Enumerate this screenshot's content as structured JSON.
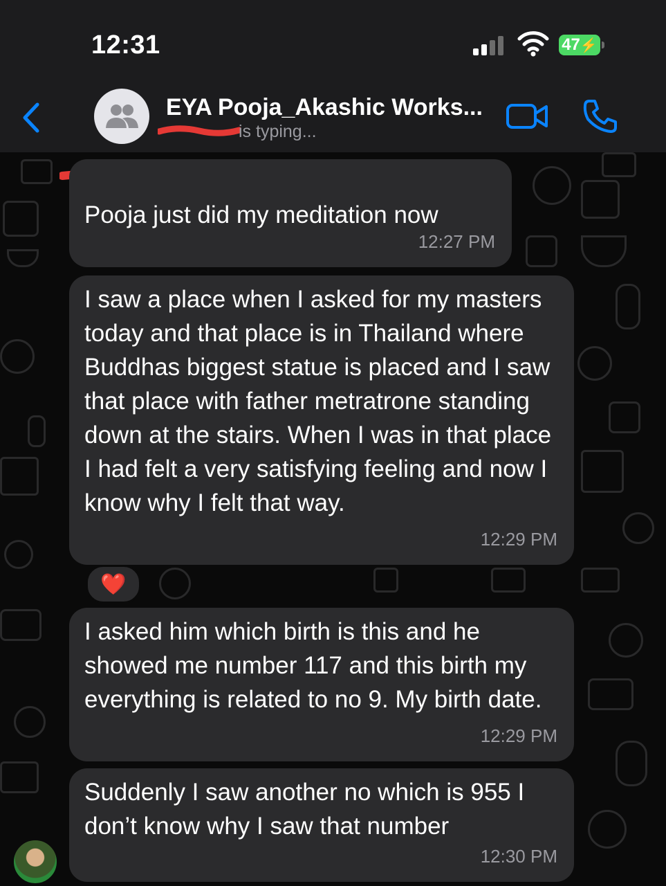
{
  "status_bar": {
    "time": "12:31",
    "battery": "47"
  },
  "header": {
    "title": "EYA Pooja_Akashic Works...",
    "status": "is typing...",
    "icons": {
      "back": "chevron-left-icon",
      "video": "video-camera-icon",
      "call": "phone-icon",
      "group": "group-avatar-icon"
    }
  },
  "colors": {
    "accent": "#0a84ff",
    "bubble": "#2b2b2d",
    "background": "#0a0a0a",
    "battery": "#4cd964"
  },
  "messages": [
    {
      "text": "Pooja just did my meditation now",
      "time": "12:27 PM"
    },
    {
      "text": "I saw a place when I asked for my masters today and that place is in Thailand where Buddhas biggest statue is placed and I saw that place with father metratrone standing down at the stairs. When I was in that place I had felt a very satisfying feeling and now I know why I felt that way.",
      "time": "12:29 PM",
      "reaction": "❤️"
    },
    {
      "text": "I asked him which birth is this and he showed me number 117 and this birth my everything is related to no 9. My birth date.",
      "time": "12:29 PM"
    },
    {
      "text": "Suddenly I saw another no which is 955 I don’t know why I saw that number",
      "time": "12:30 PM"
    }
  ]
}
